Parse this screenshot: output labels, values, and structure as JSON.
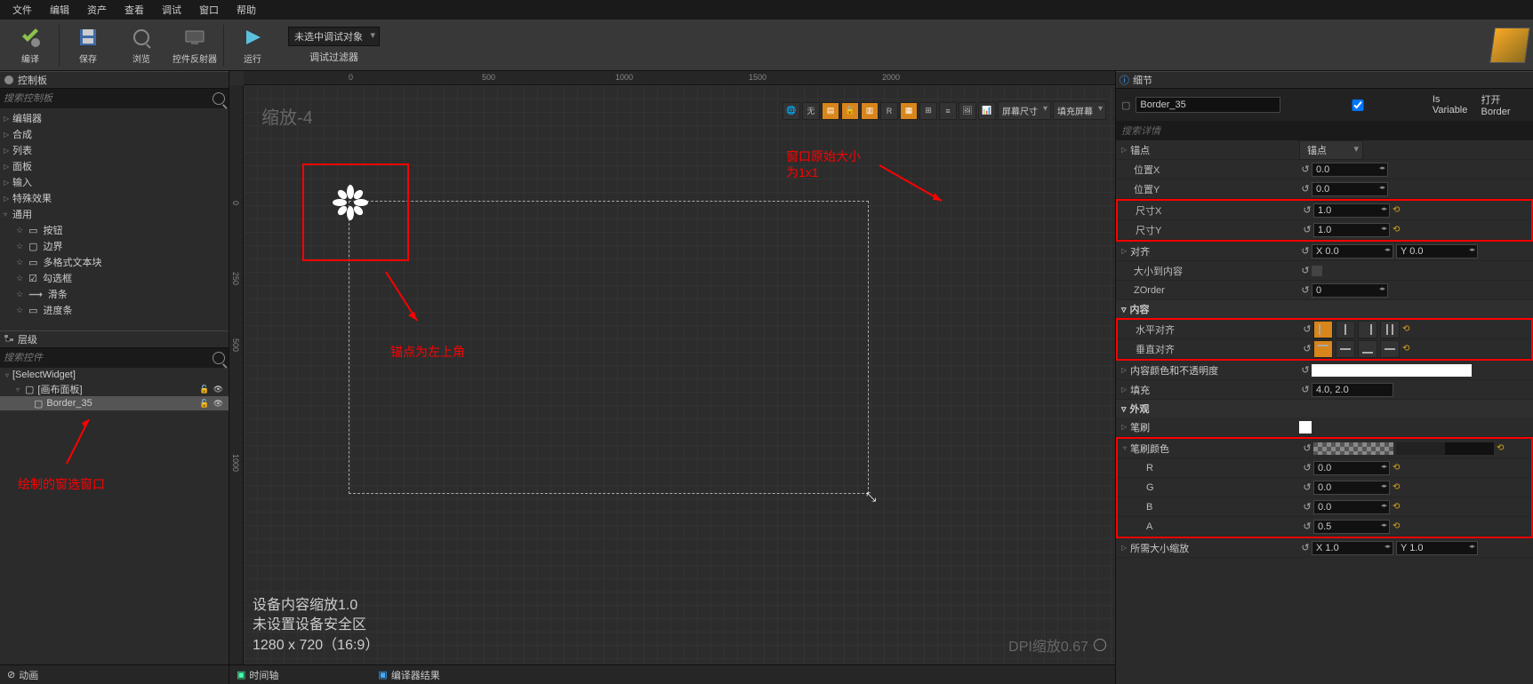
{
  "menu": {
    "file": "文件",
    "edit": "编辑",
    "asset": "资产",
    "view": "查看",
    "debug": "调试",
    "window": "窗口",
    "help": "帮助"
  },
  "toolbar": {
    "compile": "编译",
    "save": "保存",
    "browse": "浏览",
    "reflector": "控件反射器",
    "run": "运行",
    "debugTarget": "未选中调试对象",
    "debugFilter": "调试过滤器"
  },
  "palette": {
    "title": "控制板",
    "search": "搜索控制板",
    "items": [
      "编辑器",
      "合成",
      "列表",
      "面板",
      "输入",
      "特殊效果"
    ],
    "common": "通用",
    "commonItems": [
      "按钮",
      "边界",
      "多格式文本块",
      "勾选框",
      "滑条",
      "进度条"
    ]
  },
  "hierarchy": {
    "title": "层级",
    "search": "搜索控件",
    "root": "[SelectWidget]",
    "canvas": "[画布面板]",
    "border": "Border_35"
  },
  "viewport": {
    "zoomLabel": "缩放-4",
    "deviceScale": "设备内容缩放1.0",
    "safeArea": "未设置设备安全区",
    "res": "1280 x 720（16:9）",
    "dpi": "DPI缩放0.67",
    "screenSize": "屏幕尺寸",
    "fillScreen": "填充屏幕",
    "btnNone": "无",
    "btnR": "R",
    "ruler": {
      "r0": "0",
      "r500": "500",
      "r1000": "1000",
      "r1500": "1500",
      "r2000": "2000",
      "v250": "250",
      "v500": "500"
    }
  },
  "annotations": {
    "redBox1": "",
    "anchorText": "锚点为左上角",
    "windowText1": "窗口原始大小",
    "windowText2": "为1x1",
    "drawText": "绘制的窗选窗口"
  },
  "details": {
    "title": "细节",
    "objName": "Border_35",
    "isVar": "Is Variable",
    "open": "打开Border",
    "searchDetails": "搜索详情",
    "anchors": "锚点",
    "anchorBtn": "锚点",
    "posX": "位置X",
    "posXVal": "0.0",
    "posY": "位置Y",
    "posYVal": "0.0",
    "sizeX": "尺寸X",
    "sizeXVal": "1.0",
    "sizeY": "尺寸Y",
    "sizeYVal": "1.0",
    "align": "对齐",
    "alignXPrefix": "X",
    "alignX": "0.0",
    "alignYPrefix": "Y",
    "alignY": "0.0",
    "sizeToContent": "大小到内容",
    "zorder": "ZOrder",
    "zorderVal": "0",
    "content": "内容",
    "hAlign": "水平对齐",
    "vAlign": "垂直对齐",
    "contentColor": "内容颜色和不透明度",
    "padding": "填充",
    "paddingVal": "4.0, 2.0",
    "appearance": "外观",
    "brush": "笔刷",
    "brushColor": "笔刷颜色",
    "r": "R",
    "rVal": "0.0",
    "g": "G",
    "gVal": "0.0",
    "b": "B",
    "bVal": "0.0",
    "a": "A",
    "aVal": "0.5",
    "desiredScale": "所需大小缩放",
    "dsX": "1.0",
    "dsY": "1.0"
  },
  "bottomTabs": {
    "anim": "动画",
    "timeline": "时间轴",
    "compilerResults": "编译器结果"
  }
}
